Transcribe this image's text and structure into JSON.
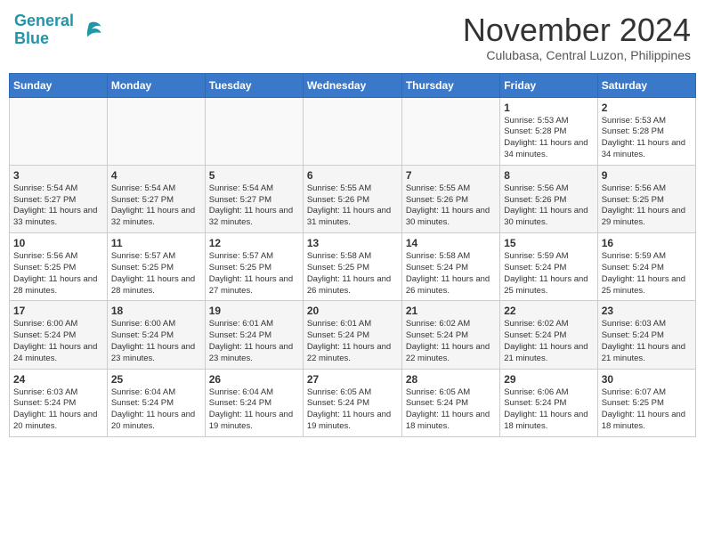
{
  "header": {
    "logo_line1": "General",
    "logo_line2": "Blue",
    "month_title": "November 2024",
    "location": "Culubasa, Central Luzon, Philippines"
  },
  "columns": [
    "Sunday",
    "Monday",
    "Tuesday",
    "Wednesday",
    "Thursday",
    "Friday",
    "Saturday"
  ],
  "weeks": [
    [
      {
        "day": "",
        "info": ""
      },
      {
        "day": "",
        "info": ""
      },
      {
        "day": "",
        "info": ""
      },
      {
        "day": "",
        "info": ""
      },
      {
        "day": "",
        "info": ""
      },
      {
        "day": "1",
        "info": "Sunrise: 5:53 AM\nSunset: 5:28 PM\nDaylight: 11 hours\nand 34 minutes."
      },
      {
        "day": "2",
        "info": "Sunrise: 5:53 AM\nSunset: 5:28 PM\nDaylight: 11 hours\nand 34 minutes."
      }
    ],
    [
      {
        "day": "3",
        "info": "Sunrise: 5:54 AM\nSunset: 5:27 PM\nDaylight: 11 hours\nand 33 minutes."
      },
      {
        "day": "4",
        "info": "Sunrise: 5:54 AM\nSunset: 5:27 PM\nDaylight: 11 hours\nand 32 minutes."
      },
      {
        "day": "5",
        "info": "Sunrise: 5:54 AM\nSunset: 5:27 PM\nDaylight: 11 hours\nand 32 minutes."
      },
      {
        "day": "6",
        "info": "Sunrise: 5:55 AM\nSunset: 5:26 PM\nDaylight: 11 hours\nand 31 minutes."
      },
      {
        "day": "7",
        "info": "Sunrise: 5:55 AM\nSunset: 5:26 PM\nDaylight: 11 hours\nand 30 minutes."
      },
      {
        "day": "8",
        "info": "Sunrise: 5:56 AM\nSunset: 5:26 PM\nDaylight: 11 hours\nand 30 minutes."
      },
      {
        "day": "9",
        "info": "Sunrise: 5:56 AM\nSunset: 5:25 PM\nDaylight: 11 hours\nand 29 minutes."
      }
    ],
    [
      {
        "day": "10",
        "info": "Sunrise: 5:56 AM\nSunset: 5:25 PM\nDaylight: 11 hours\nand 28 minutes."
      },
      {
        "day": "11",
        "info": "Sunrise: 5:57 AM\nSunset: 5:25 PM\nDaylight: 11 hours\nand 28 minutes."
      },
      {
        "day": "12",
        "info": "Sunrise: 5:57 AM\nSunset: 5:25 PM\nDaylight: 11 hours\nand 27 minutes."
      },
      {
        "day": "13",
        "info": "Sunrise: 5:58 AM\nSunset: 5:25 PM\nDaylight: 11 hours\nand 26 minutes."
      },
      {
        "day": "14",
        "info": "Sunrise: 5:58 AM\nSunset: 5:24 PM\nDaylight: 11 hours\nand 26 minutes."
      },
      {
        "day": "15",
        "info": "Sunrise: 5:59 AM\nSunset: 5:24 PM\nDaylight: 11 hours\nand 25 minutes."
      },
      {
        "day": "16",
        "info": "Sunrise: 5:59 AM\nSunset: 5:24 PM\nDaylight: 11 hours\nand 25 minutes."
      }
    ],
    [
      {
        "day": "17",
        "info": "Sunrise: 6:00 AM\nSunset: 5:24 PM\nDaylight: 11 hours\nand 24 minutes."
      },
      {
        "day": "18",
        "info": "Sunrise: 6:00 AM\nSunset: 5:24 PM\nDaylight: 11 hours\nand 23 minutes."
      },
      {
        "day": "19",
        "info": "Sunrise: 6:01 AM\nSunset: 5:24 PM\nDaylight: 11 hours\nand 23 minutes."
      },
      {
        "day": "20",
        "info": "Sunrise: 6:01 AM\nSunset: 5:24 PM\nDaylight: 11 hours\nand 22 minutes."
      },
      {
        "day": "21",
        "info": "Sunrise: 6:02 AM\nSunset: 5:24 PM\nDaylight: 11 hours\nand 22 minutes."
      },
      {
        "day": "22",
        "info": "Sunrise: 6:02 AM\nSunset: 5:24 PM\nDaylight: 11 hours\nand 21 minutes."
      },
      {
        "day": "23",
        "info": "Sunrise: 6:03 AM\nSunset: 5:24 PM\nDaylight: 11 hours\nand 21 minutes."
      }
    ],
    [
      {
        "day": "24",
        "info": "Sunrise: 6:03 AM\nSunset: 5:24 PM\nDaylight: 11 hours\nand 20 minutes."
      },
      {
        "day": "25",
        "info": "Sunrise: 6:04 AM\nSunset: 5:24 PM\nDaylight: 11 hours\nand 20 minutes."
      },
      {
        "day": "26",
        "info": "Sunrise: 6:04 AM\nSunset: 5:24 PM\nDaylight: 11 hours\nand 19 minutes."
      },
      {
        "day": "27",
        "info": "Sunrise: 6:05 AM\nSunset: 5:24 PM\nDaylight: 11 hours\nand 19 minutes."
      },
      {
        "day": "28",
        "info": "Sunrise: 6:05 AM\nSunset: 5:24 PM\nDaylight: 11 hours\nand 18 minutes."
      },
      {
        "day": "29",
        "info": "Sunrise: 6:06 AM\nSunset: 5:24 PM\nDaylight: 11 hours\nand 18 minutes."
      },
      {
        "day": "30",
        "info": "Sunrise: 6:07 AM\nSunset: 5:25 PM\nDaylight: 11 hours\nand 18 minutes."
      }
    ]
  ]
}
